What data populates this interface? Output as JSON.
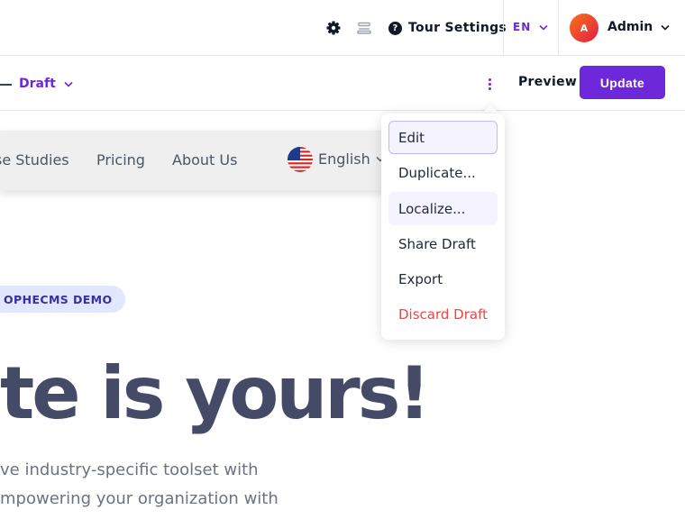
{
  "topbar": {
    "tour_label": "Tour Settings",
    "language": "EN",
    "avatar_initial": "A",
    "user_name": "Admin"
  },
  "subbar": {
    "status": "Draft",
    "preview_label": "Preview",
    "update_label": "Update"
  },
  "page_preview": {
    "nav_items": [
      "se Studies",
      "Pricing",
      "About Us"
    ],
    "language": "English",
    "badge": "OPHECMS DEMO",
    "hero_text": "te is yours!",
    "lead_lines": [
      "ve industry-specific toolset with",
      "mpowering your organization with"
    ]
  },
  "menu": {
    "items": [
      "Edit",
      "Duplicate...",
      "Localize...",
      "Share Draft",
      "Export",
      "Discard Draft"
    ]
  },
  "colors": {
    "accent": "#6d28d9",
    "danger": "#ef4444",
    "hero": "#454a66"
  }
}
